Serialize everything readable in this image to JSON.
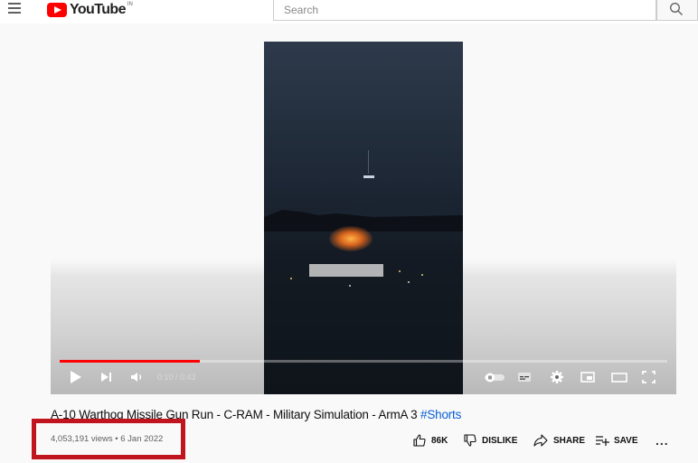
{
  "header": {
    "logo_text": "YouTube",
    "logo_region": "IN",
    "search_placeholder": "Search"
  },
  "player": {
    "time": "0:10 / 0:43",
    "progress": 0.23
  },
  "video": {
    "title": "A-10 Warthog Missile Gun Run - C-RAM - Military Simulation - ArmA 3",
    "hashtag": "#Shorts",
    "meta": "4,053,191 views • 6 Jan 2022"
  },
  "actions": {
    "like": "86K",
    "dislike": "DISLIKE",
    "share": "SHARE",
    "save": "SAVE",
    "more": "..."
  },
  "colors": {
    "brand": "#ff0000",
    "highlight_box": "#c0151f",
    "hashtag": "#065fd4"
  }
}
